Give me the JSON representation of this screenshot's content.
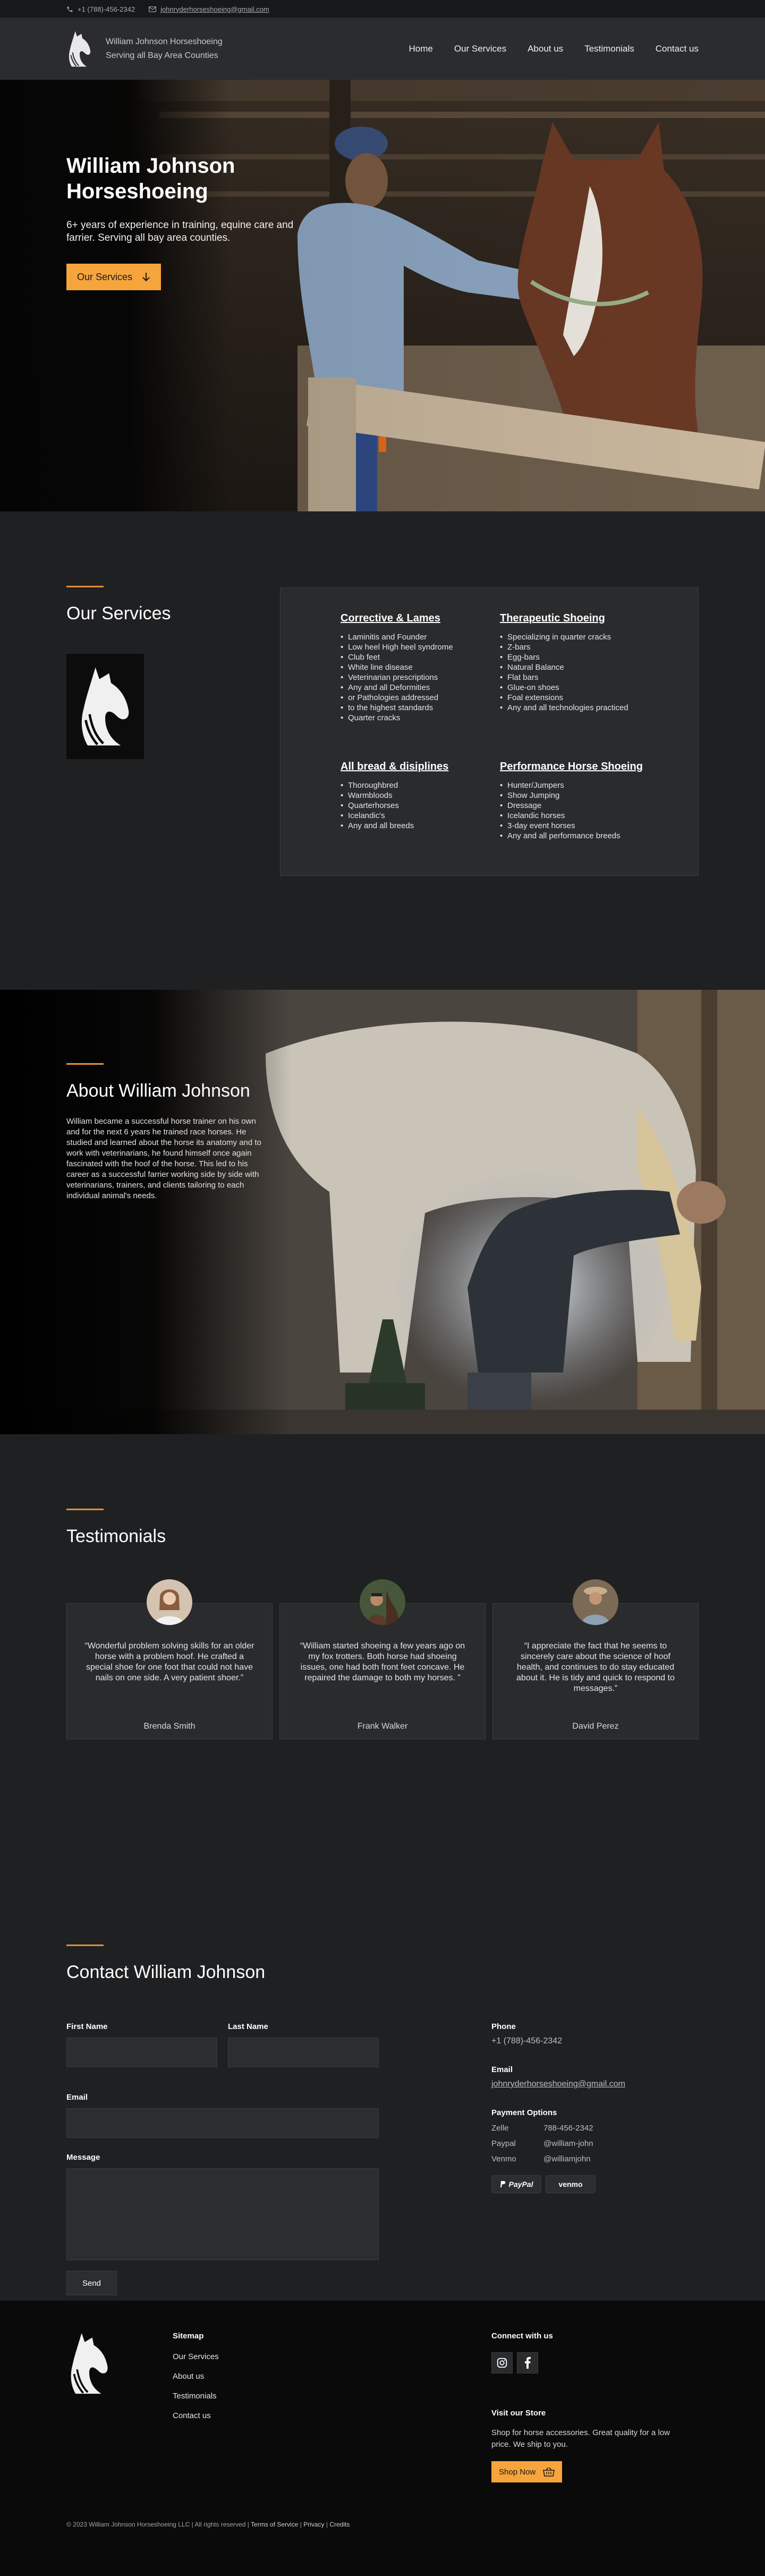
{
  "topbar": {
    "phone": "+1 (788)-456-2342",
    "email": "johnryderhorseshoeing@gmail.com"
  },
  "nav": {
    "brand_line1": "William Johnson Horseshoeing",
    "brand_line2": "Serving all Bay Area Counties",
    "items": [
      "Home",
      "Our Services",
      "About us",
      "Testimonials",
      "Contact us"
    ]
  },
  "hero": {
    "title": "William Johnson Horseshoeing",
    "subtitle": "6+ years of experience in training, equine care and farrier. Serving all bay area counties.",
    "cta": "Our Services"
  },
  "services": {
    "title": "Our Services",
    "categories": [
      {
        "title": "Corrective & Lames",
        "items": [
          "Laminitis and Founder",
          "Low heel High heel syndrome",
          "Club feet",
          "White line disease",
          "Veterinarian prescriptions",
          "Any and all Deformities",
          "or Pathologies addressed",
          "to the highest standards",
          "Quarter cracks"
        ]
      },
      {
        "title": "Therapeutic Shoeing",
        "items": [
          "Specializing in quarter cracks",
          "Z-bars",
          "Egg-bars",
          "Natural Balance",
          "Flat bars",
          "Glue-on shoes",
          "Foal extensions",
          "Any and all technologies practiced"
        ]
      },
      {
        "title": "All bread & disiplines",
        "items": [
          "Thoroughbred",
          "Warmbloods",
          "Quarterhorses",
          "Icelandic's",
          "Any and all breeds"
        ]
      },
      {
        "title": "Performance Horse Shoeing",
        "items": [
          "Hunter/Jumpers",
          "Show Jumping",
          "Dressage",
          "Icelandic horses",
          "3-day event horses",
          "Any and all performance breeds"
        ]
      }
    ]
  },
  "about": {
    "title": "About William Johnson",
    "body": "William became a successful horse trainer on his own and for the next 6 years he trained race horses. He studied and learned about the horse its anatomy and to work with veterinarians, he found himself once again fascinated with the hoof of the horse. This led to his career as a successful farrier working side by side with veterinarians, trainers, and clients tailoring to each individual animal's needs."
  },
  "testimonials": {
    "title": "Testimonials",
    "items": [
      {
        "quote": "“Wonderful problem solving skills for an older horse with a problem hoof. He crafted a special shoe for one foot that could not have nails on one side. A very patient shoer.”",
        "author": "Brenda Smith"
      },
      {
        "quote": "“William started shoeing a few years ago on my fox trotters. Both horse had shoeing issues, one had both front feet concave. He repaired the damage to both my horses. ”",
        "author": "Frank Walker"
      },
      {
        "quote": "“I appreciate the fact that he seems to sincerely care about the science of hoof health, and continues to do stay educated about it. He is tidy and quick to respond to messages.”",
        "author": "David Perez"
      }
    ]
  },
  "contact": {
    "title": "Contact William Johnson",
    "first_name_label": "First Name",
    "last_name_label": "Last Name",
    "email_label": "Email",
    "message_label": "Message",
    "send_label": "Send",
    "phone_label": "Phone",
    "phone": "+1 (788)-456-2342",
    "email_info_label": "Email",
    "email": "johnryderhorseshoeing@gmail.com",
    "payment_label": "Payment Options",
    "payments": [
      {
        "name": "Zelle",
        "value": "788-456-2342"
      },
      {
        "name": "Paypal",
        "value": "@william-john"
      },
      {
        "name": "Venmo",
        "value": "@williamjohn"
      }
    ],
    "paypal_btn": "PayPal",
    "venmo_btn": "venmo"
  },
  "footer": {
    "sitemap_title": "Sitemap",
    "sitemap": [
      "Our Services",
      "About us",
      "Testimonials",
      "Contact us"
    ],
    "connect_title": "Connect with us",
    "store_title": "Visit our Store",
    "store_text": "Shop for horse accessories. Great quality for a low price. We ship to you.",
    "shop_btn": "Shop Now",
    "copyright": "© 2023 William Johnson Horseshoeing LLC | All rights reserved |",
    "terms": "Terms of Service",
    "privacy": "Privacy",
    "credits": "Credits"
  },
  "colors": {
    "accent": "#f6a43c",
    "background": "#1f2022",
    "panel": "#2a2b2d"
  }
}
